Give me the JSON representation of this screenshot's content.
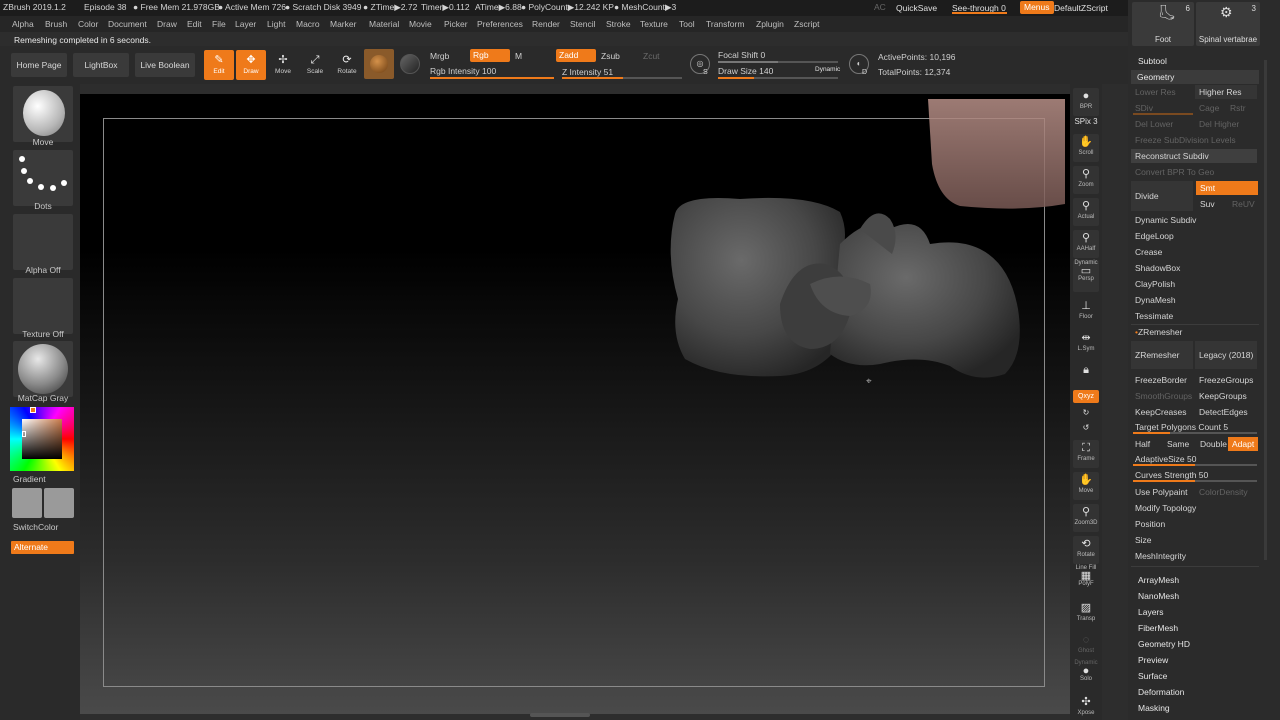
{
  "titlebar": {
    "app": "ZBrush 2019.1.2",
    "episode": "Episode 38",
    "free_mem": "● Free Mem 21.978GB",
    "active_mem": "● Active Mem 726",
    "scratch": "● Scratch Disk 3949",
    "ztime": "● ZTime▶2.72",
    "timer": "Timer▶0.112",
    "atime": "ATime▶6.88",
    "polycount": "● PolyCount▶12.242 KP",
    "meshcount": "● MeshCount▶3",
    "ac": "AC",
    "quicksave": "QuickSave",
    "see_through": "See-through",
    "see_through_value": "0",
    "menus": "Menus",
    "script": "DefaultZScript"
  },
  "menubar": [
    "Alpha",
    "Brush",
    "Color",
    "Document",
    "Draw",
    "Edit",
    "File",
    "Layer",
    "Light",
    "Macro",
    "Marker",
    "Material",
    "Movie",
    "Picker",
    "Preferences",
    "Render",
    "Stencil",
    "Stroke",
    "Texture",
    "Tool",
    "Transform",
    "Zplugin",
    "Zscript"
  ],
  "status_message": "Remeshing completed in 6 seconds.",
  "toolbar": {
    "home": "Home Page",
    "lightbox": "LightBox",
    "live_boolean": "Live Boolean",
    "edit": "Edit",
    "draw": "Draw",
    "move": "Move",
    "scale": "Scale",
    "rotate": "Rotate",
    "mrgb": "Mrgb",
    "rgb": "Rgb",
    "m": "M",
    "rgb_intensity_label": "Rgb Intensity",
    "rgb_intensity": "100",
    "rgb_intensity_pct": 100,
    "zadd": "Zadd",
    "zsub": "Zsub",
    "zcut": "Zcut",
    "z_intensity_label": "Z Intensity",
    "z_intensity": "51",
    "z_intensity_pct": 51,
    "focal_shift_label": "Focal Shift",
    "focal_shift": "0",
    "draw_size_label": "Draw Size",
    "draw_size": "140",
    "dynamic": "Dynamic",
    "active_points_label": "ActivePoints:",
    "active_points": "10,196",
    "total_points_label": "TotalPoints:",
    "total_points": "12,374",
    "s_key": "S",
    "d_key": "D"
  },
  "left_shelf": {
    "brush": "Move",
    "stroke": "Dots",
    "alpha": "Alpha Off",
    "texture": "Texture Off",
    "material": "MatCap Gray",
    "gradient": "Gradient",
    "switch_color": "SwitchColor",
    "alternate": "Alternate"
  },
  "right_shelf": {
    "bpr": "BPR",
    "spix": "SPix 3",
    "scroll": "Scroll",
    "zoom": "Zoom",
    "actual": "Actual",
    "aahalf": "AAHalf",
    "persp_top": "Dynamic",
    "persp": "Persp",
    "floor": "Floor",
    "lsym": "L.Sym",
    "qxyz": "Qxyz",
    "frame": "Frame",
    "move": "Move",
    "zoom3d": "Zoom3D",
    "rotate": "Rotate",
    "linefill": "Line Fill",
    "polyf": "PolyF",
    "transp": "Transp",
    "ghost": "Ghost",
    "solo_top": "Dynamic",
    "solo": "Solo",
    "xpose": "Xpose"
  },
  "right_panel": {
    "thumb1": "Foot",
    "thumb1_count": "6",
    "thumb2": "Spinal vertabrae",
    "thumb2_count": "3",
    "subtool": "Subtool",
    "geometry": "Geometry",
    "lower_res": "Lower Res",
    "higher_res": "Higher Res",
    "sdiv": "SDiv",
    "cage": "Cage",
    "rstr": "Rstr",
    "del_lower": "Del Lower",
    "del_higher": "Del Higher",
    "freeze_subdiv": "Freeze SubDivision Levels",
    "reconstruct": "Reconstruct Subdiv",
    "convert_bpr": "Convert BPR To Geo",
    "divide": "Divide",
    "smt": "Smt",
    "suv": "Suv",
    "reuv": "ReUV",
    "dynamic_subdiv": "Dynamic Subdiv",
    "edgeloop": "EdgeLoop",
    "crease": "Crease",
    "shadowbox": "ShadowBox",
    "claypolish": "ClayPolish",
    "dynamesh": "DynaMesh",
    "tessimate": "Tessimate",
    "zremesher_head": "ZRemesher",
    "zremesher_btn": "ZRemesher",
    "legacy": "Legacy (2018)",
    "freeze_border": "FreezeBorder",
    "freeze_groups": "FreezeGroups",
    "smooth_groups": "SmoothGroups",
    "keep_groups": "KeepGroups",
    "keep_creases": "KeepCreases",
    "detect_edges": "DetectEdges",
    "target_poly_label": "Target Polygons Count",
    "target_poly": "5",
    "half": "Half",
    "same": "Same",
    "double": "Double",
    "adapt": "Adapt",
    "adaptive_size_label": "AdaptiveSize",
    "adaptive_size": "50",
    "curves_strength_label": "Curves Strength",
    "curves_strength": "50",
    "use_polypaint": "Use Polypaint",
    "color_density": "ColorDensity",
    "modify_topology": "Modify Topology",
    "position": "Position",
    "size": "Size",
    "mesh_integrity": "MeshIntegrity",
    "array_mesh": "ArrayMesh",
    "nano_mesh": "NanoMesh",
    "layers": "Layers",
    "fiber_mesh": "FiberMesh",
    "geometry_hd": "Geometry HD",
    "preview": "Preview",
    "surface": "Surface",
    "deformation": "Deformation",
    "masking": "Masking"
  },
  "colors": {
    "accent": "#ef7a1a",
    "bg": "#2d2d2d",
    "panel": "#2b2b2b"
  }
}
